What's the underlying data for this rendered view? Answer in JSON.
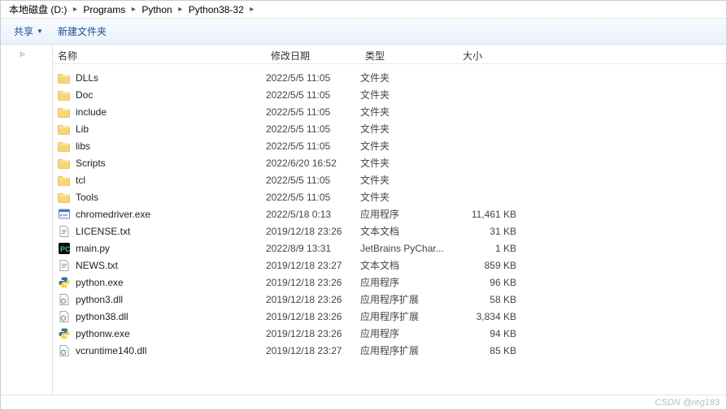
{
  "breadcrumb": [
    {
      "label": "本地磁盘 (D:)"
    },
    {
      "label": "Programs"
    },
    {
      "label": "Python"
    },
    {
      "label": "Python38-32"
    }
  ],
  "toolbar": {
    "share": "共享",
    "new_folder": "新建文件夹"
  },
  "columns": {
    "name": "名称",
    "date": "修改日期",
    "type": "类型",
    "size": "大小"
  },
  "files": [
    {
      "name": "DLLs",
      "date": "2022/5/5 11:05",
      "type": "文件夹",
      "size": "",
      "icon": "folder"
    },
    {
      "name": "Doc",
      "date": "2022/5/5 11:05",
      "type": "文件夹",
      "size": "",
      "icon": "folder"
    },
    {
      "name": "include",
      "date": "2022/5/5 11:05",
      "type": "文件夹",
      "size": "",
      "icon": "folder"
    },
    {
      "name": "Lib",
      "date": "2022/5/5 11:05",
      "type": "文件夹",
      "size": "",
      "icon": "folder"
    },
    {
      "name": "libs",
      "date": "2022/5/5 11:05",
      "type": "文件夹",
      "size": "",
      "icon": "folder"
    },
    {
      "name": "Scripts",
      "date": "2022/6/20 16:52",
      "type": "文件夹",
      "size": "",
      "icon": "folder"
    },
    {
      "name": "tcl",
      "date": "2022/5/5 11:05",
      "type": "文件夹",
      "size": "",
      "icon": "folder"
    },
    {
      "name": "Tools",
      "date": "2022/5/5 11:05",
      "type": "文件夹",
      "size": "",
      "icon": "folder"
    },
    {
      "name": "chromedriver.exe",
      "date": "2022/5/18 0:13",
      "type": "应用程序",
      "size": "11,461 KB",
      "icon": "exe"
    },
    {
      "name": "LICENSE.txt",
      "date": "2019/12/18 23:26",
      "type": "文本文档",
      "size": "31 KB",
      "icon": "txt"
    },
    {
      "name": "main.py",
      "date": "2022/8/9 13:31",
      "type": "JetBrains PyChar...",
      "size": "1 KB",
      "icon": "py"
    },
    {
      "name": "NEWS.txt",
      "date": "2019/12/18 23:27",
      "type": "文本文档",
      "size": "859 KB",
      "icon": "txt"
    },
    {
      "name": "python.exe",
      "date": "2019/12/18 23:26",
      "type": "应用程序",
      "size": "96 KB",
      "icon": "python"
    },
    {
      "name": "python3.dll",
      "date": "2019/12/18 23:26",
      "type": "应用程序扩展",
      "size": "58 KB",
      "icon": "dll"
    },
    {
      "name": "python38.dll",
      "date": "2019/12/18 23:26",
      "type": "应用程序扩展",
      "size": "3,834 KB",
      "icon": "dll"
    },
    {
      "name": "pythonw.exe",
      "date": "2019/12/18 23:26",
      "type": "应用程序",
      "size": "94 KB",
      "icon": "python"
    },
    {
      "name": "vcruntime140.dll",
      "date": "2019/12/18 23:27",
      "type": "应用程序扩展",
      "size": "85 KB",
      "icon": "dll"
    }
  ],
  "watermark": "CSDN @reg183"
}
